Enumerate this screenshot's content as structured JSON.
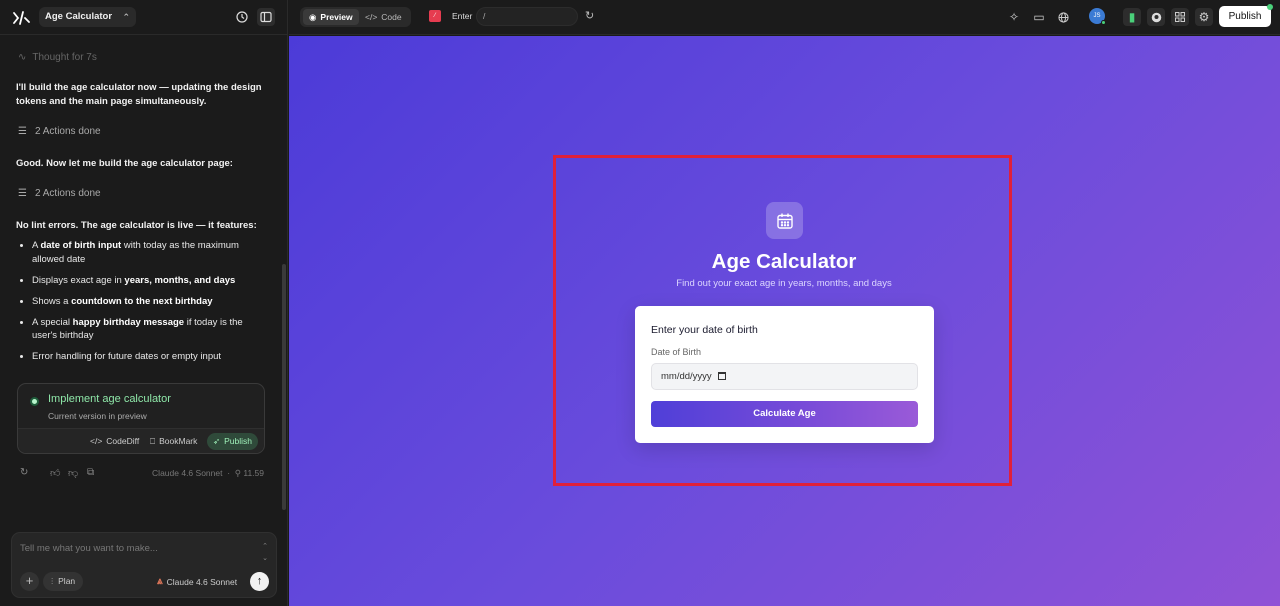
{
  "project": {
    "name": "Age Calculator"
  },
  "chat": {
    "thought": "Thought for 7s",
    "msg1": "I'll build the age calculator now — updating the design tokens and the main page simultaneously.",
    "actions1": "2 Actions done",
    "msg2": "Good. Now let me build the age calculator page:",
    "actions2": "2 Actions done",
    "msg3": "No lint errors. The age calculator is live — it features:",
    "features": [
      {
        "pre": "A ",
        "bold": "date of birth input",
        "post": " with today as the maximum allowed date"
      },
      {
        "pre": "Displays exact age in ",
        "bold": "years, months, and days",
        "post": ""
      },
      {
        "pre": "Shows a ",
        "bold": "countdown to the next birthday",
        "post": ""
      },
      {
        "pre": "A special ",
        "bold": "happy birthday message",
        "post": " if today is the user's birthday"
      },
      {
        "pre": "Error handling for future dates or empty input",
        "bold": "",
        "post": ""
      }
    ],
    "version_card": {
      "title": "Implement age calculator",
      "subtitle": "Current version in preview",
      "codediff": "CodeDiff",
      "bookmark": "BookMark",
      "publish": "Publish"
    },
    "meta": {
      "model": "Claude 4.6 Sonnet",
      "cost": "11.59"
    }
  },
  "composer": {
    "placeholder": "Tell me what you want to make...",
    "plan": "Plan",
    "model": "Claude 4.6 Sonnet"
  },
  "topbar": {
    "preview": "Preview",
    "code": "Code",
    "enter": "Enter",
    "path": "/",
    "publish": "Publish",
    "avatar": "JS"
  },
  "app": {
    "title": "Age Calculator",
    "subtitle": "Find out your exact age in years, months, and days",
    "card_heading": "Enter your date of birth",
    "dob_label": "Date of Birth",
    "dob_placeholder": "mm/dd/yyyy",
    "calc_button": "Calculate Age"
  },
  "colors": {
    "accent_green": "#8ee6a8",
    "highlight_red": "#e0203a",
    "gradient_start": "#4c3bd8",
    "gradient_end": "#9052d6"
  }
}
